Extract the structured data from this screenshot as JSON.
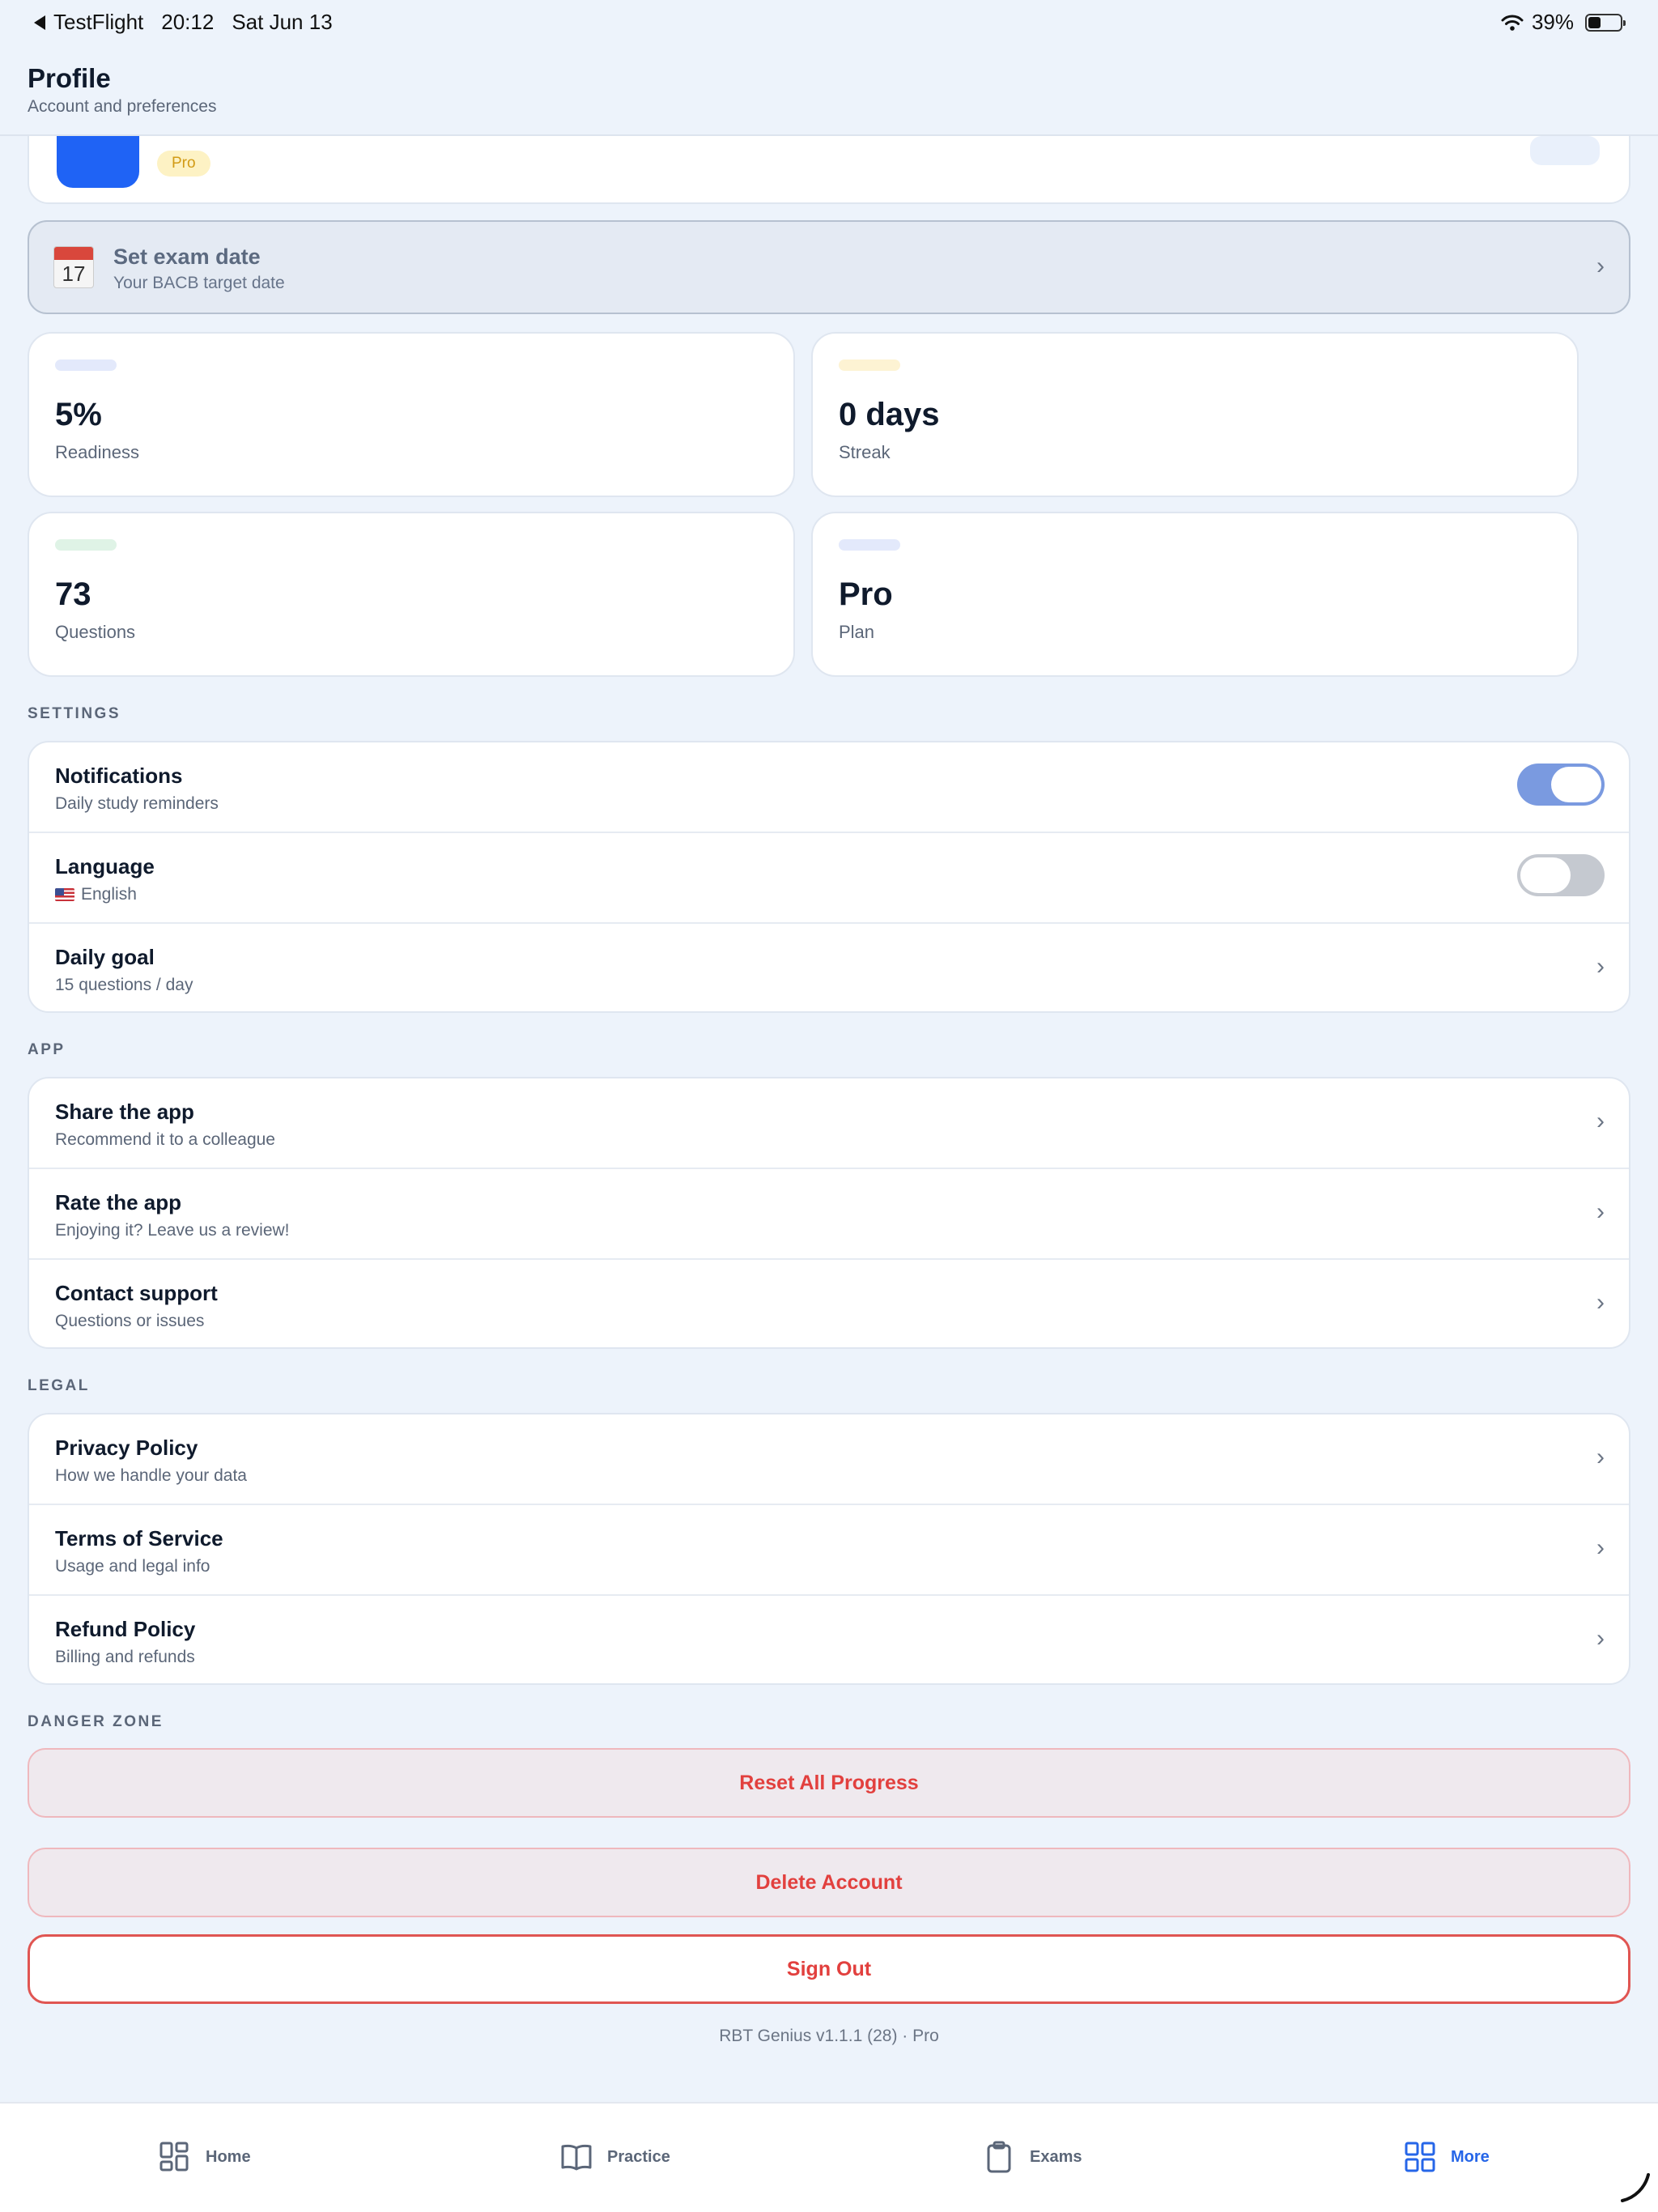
{
  "status_bar": {
    "back_app": "TestFlight",
    "time": "20:12",
    "date": "Sat Jun 13",
    "battery": "39%"
  },
  "header": {
    "title": "Profile",
    "subtitle": "Account and preferences"
  },
  "profile": {
    "badge": "Pro"
  },
  "exam_date": {
    "title": "Set exam date",
    "subtitle": "Your BACB target date",
    "calendar_day": "17"
  },
  "stats": [
    {
      "value": "5%",
      "label": "Readiness",
      "color": "#e3e9fb"
    },
    {
      "value": "0 days",
      "label": "Streak",
      "color": "#fdf3d3"
    },
    {
      "value": "73",
      "label": "Questions",
      "color": "#dff3e6"
    },
    {
      "value": "Pro",
      "label": "Plan",
      "color": "#e3e9fb"
    }
  ],
  "settings": {
    "heading": "SETTINGS",
    "notifications": {
      "title": "Notifications",
      "subtitle": "Daily study reminders",
      "enabled": true
    },
    "language": {
      "title": "Language",
      "subtitle": "English",
      "enabled": false
    },
    "daily_goal": {
      "title": "Daily goal",
      "subtitle": "15 questions / day"
    }
  },
  "app": {
    "heading": "APP",
    "items": [
      {
        "title": "Share the app",
        "subtitle": "Recommend it to a colleague"
      },
      {
        "title": "Rate the app",
        "subtitle": "Enjoying it? Leave us a review!"
      },
      {
        "title": "Contact support",
        "subtitle": "Questions or issues"
      }
    ]
  },
  "legal": {
    "heading": "LEGAL",
    "items": [
      {
        "title": "Privacy Policy",
        "subtitle": "How we handle your data"
      },
      {
        "title": "Terms of Service",
        "subtitle": "Usage and legal info"
      },
      {
        "title": "Refund Policy",
        "subtitle": "Billing and refunds"
      }
    ]
  },
  "danger": {
    "heading": "DANGER ZONE",
    "reset": "Reset All Progress",
    "delete": "Delete Account",
    "signout": "Sign Out",
    "color": "#e2403e"
  },
  "version": "RBT Genius v1.1.1 (28) · Pro",
  "tabs": [
    {
      "label": "Home",
      "icon": "home-grid-icon"
    },
    {
      "label": "Practice",
      "icon": "book-icon"
    },
    {
      "label": "Exams",
      "icon": "clipboard-icon"
    },
    {
      "label": "More",
      "icon": "more-grid-icon",
      "active": true
    }
  ],
  "accent": "#2666e8"
}
